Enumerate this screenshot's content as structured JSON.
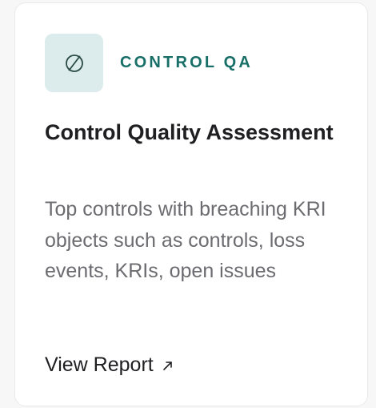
{
  "card": {
    "category": "CONTROL QA",
    "icon": "slashed-circle-icon",
    "title": "Control Quality Assessment",
    "description": "Top controls with breaching KRI objects such as controls, loss events, KRIs, open issues",
    "link_label": "View Report",
    "link_icon": "arrow-up-right-icon"
  },
  "colors": {
    "accent": "#176f68",
    "icon_tile_bg": "#dcebeb",
    "title": "#1f1f22",
    "description": "#6b6b70"
  }
}
